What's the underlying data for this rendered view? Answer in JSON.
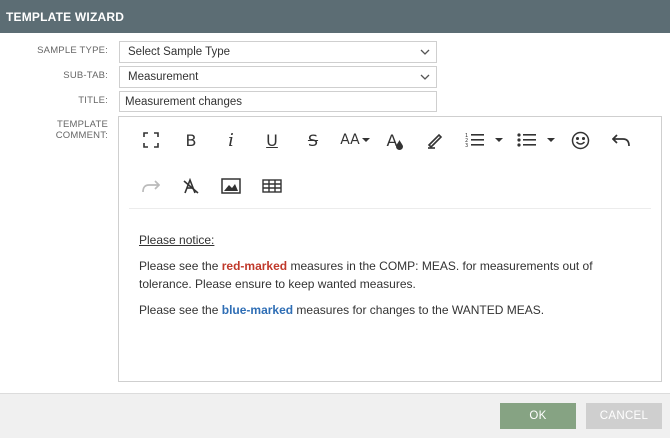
{
  "window": {
    "title": "TEMPLATE WIZARD"
  },
  "form": {
    "sample_type": {
      "label": "SAMPLE TYPE:",
      "value": "Select Sample Type"
    },
    "sub_tab": {
      "label": "SUB-TAB:",
      "value": "Measurement"
    },
    "title": {
      "label": "TITLE:",
      "value": "Measurement changes"
    },
    "template_comment": {
      "label": "TEMPLATE COMMENT:"
    }
  },
  "toolbar": {
    "bold": "B",
    "italic": "i",
    "underline": "U",
    "strikethrough": "S",
    "font_size": "AA",
    "font_color": "A",
    "icons": [
      "fullscreen-icon",
      "bold-icon",
      "italic-icon",
      "underline-icon",
      "strikethrough-icon",
      "font-size-icon",
      "font-color-icon",
      "highlighter-icon",
      "ordered-list-icon",
      "unordered-list-icon",
      "emoji-icon",
      "undo-icon",
      "redo-icon",
      "clear-format-icon",
      "image-icon",
      "table-icon"
    ]
  },
  "content": {
    "notice": "Please notice:",
    "p1_before": "Please see the ",
    "p1_red": "red-marked",
    "p1_after": " measures in the COMP: MEAS. for measurements out of tolerance. Please ensure to keep wanted measures.",
    "p2_before": "Please see the ",
    "p2_blue": "blue-marked",
    "p2_after": " measures for changes to the WANTED MEAS."
  },
  "colors": {
    "titlebar": "#5c6d74",
    "ok": "#86a383",
    "cancel": "#cfcfcf",
    "red": "#c0392b",
    "blue": "#2f6eb5"
  },
  "footer": {
    "ok_label": "OK",
    "cancel_label": "CANCEL"
  }
}
